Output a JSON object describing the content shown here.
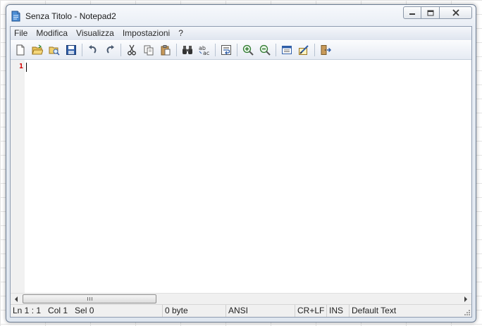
{
  "window": {
    "title": "Senza Titolo - Notepad2"
  },
  "menubar": {
    "items": [
      "File",
      "Modifica",
      "Visualizza",
      "Impostazioni",
      "?"
    ]
  },
  "toolbar": {
    "buttons": [
      {
        "icon": "new-file-icon"
      },
      {
        "icon": "open-folder-icon"
      },
      {
        "icon": "browse-icon"
      },
      {
        "icon": "save-icon"
      },
      {
        "icon": "undo-icon"
      },
      {
        "icon": "redo-icon"
      },
      {
        "icon": "cut-icon"
      },
      {
        "icon": "copy-icon"
      },
      {
        "icon": "paste-icon"
      },
      {
        "icon": "find-icon"
      },
      {
        "icon": "replace-icon"
      },
      {
        "icon": "word-wrap-icon"
      },
      {
        "icon": "zoom-in-icon"
      },
      {
        "icon": "zoom-out-icon"
      },
      {
        "icon": "scheme-icon"
      },
      {
        "icon": "customize-scheme-icon"
      },
      {
        "icon": "exit-icon"
      }
    ]
  },
  "editor": {
    "line_numbers": [
      "1"
    ]
  },
  "scrollbar": {
    "grip_label": "III"
  },
  "statusbar": {
    "position": "Ln 1 : 1   Col 1   Sel 0",
    "size": "0 byte",
    "encoding": "ANSI",
    "eol": "CR+LF",
    "mode": "INS",
    "lexer": "Default Text"
  },
  "colors": {
    "line_number": "#d50000",
    "gutter": "#f1f1f1",
    "toolbar_accent": "#2f5ea8"
  }
}
